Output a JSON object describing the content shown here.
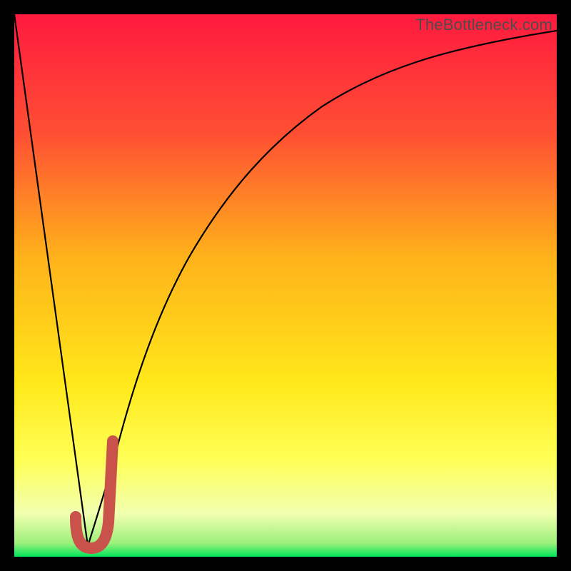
{
  "watermark": "TheBottleneck.com",
  "colors": {
    "frame": "#000000",
    "gradient_top": "#ff1a3f",
    "gradient_upper": "#ff6a2a",
    "gradient_mid": "#ffd21a",
    "gradient_lower": "#ffff55",
    "gradient_pale": "#f6ffb0",
    "gradient_green": "#00e65a",
    "curve": "#000000",
    "marker": "#c9534a"
  },
  "chart_data": {
    "type": "line",
    "title": "",
    "xlabel": "",
    "ylabel": "",
    "xlim": [
      0,
      1
    ],
    "ylim": [
      0,
      1
    ],
    "x": [
      0.0,
      0.02,
      0.04,
      0.06,
      0.08,
      0.1,
      0.12,
      0.135,
      0.15,
      0.17,
      0.19,
      0.21,
      0.24,
      0.28,
      0.32,
      0.36,
      0.4,
      0.45,
      0.5,
      0.55,
      0.6,
      0.65,
      0.7,
      0.75,
      0.8,
      0.85,
      0.9,
      0.95,
      1.0
    ],
    "values": [
      1.0,
      0.86,
      0.72,
      0.57,
      0.43,
      0.29,
      0.14,
      0.02,
      0.06,
      0.17,
      0.27,
      0.36,
      0.46,
      0.57,
      0.65,
      0.71,
      0.76,
      0.81,
      0.85,
      0.88,
      0.9,
      0.92,
      0.93,
      0.945,
      0.955,
      0.96,
      0.965,
      0.968,
      0.97
    ],
    "marker": {
      "type": "J-curve",
      "x_range": [
        0.112,
        0.175
      ],
      "y_range": [
        0.02,
        0.22
      ]
    },
    "gradient_stops": [
      {
        "pos": 0.0,
        "color": "#ff1a3f"
      },
      {
        "pos": 0.22,
        "color": "#ff4f33"
      },
      {
        "pos": 0.45,
        "color": "#ffb31a"
      },
      {
        "pos": 0.68,
        "color": "#ffe81a"
      },
      {
        "pos": 0.82,
        "color": "#ffff55"
      },
      {
        "pos": 0.92,
        "color": "#f2ffb0"
      },
      {
        "pos": 0.975,
        "color": "#9df07a"
      },
      {
        "pos": 1.0,
        "color": "#00e65a"
      }
    ]
  }
}
